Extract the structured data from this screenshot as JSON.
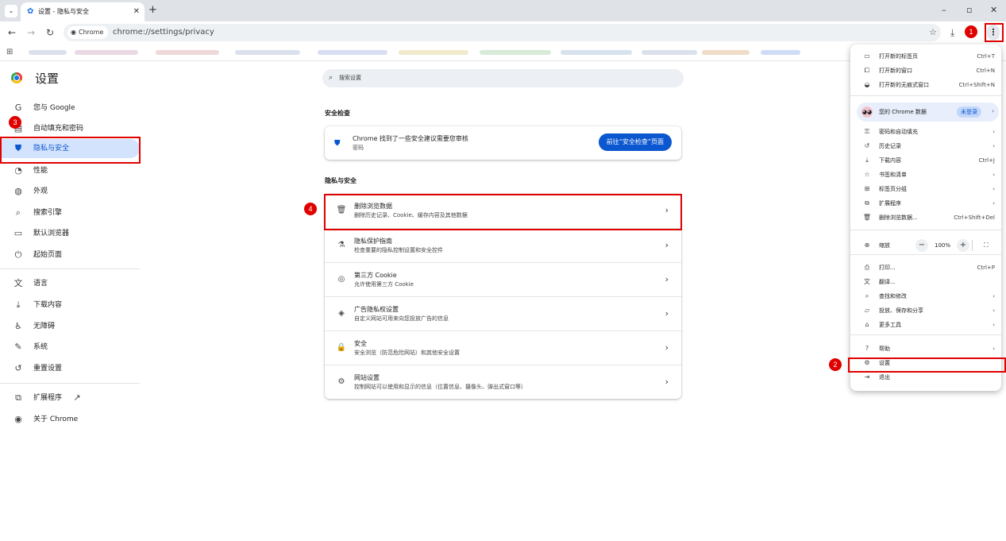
{
  "browser": {
    "tab_title": "设置 - 隐私与安全",
    "tab_close": "✕",
    "new_tab": "+",
    "chip_label": "Chrome",
    "url": "chrome://settings/privacy"
  },
  "annotations": [
    "1",
    "2",
    "3",
    "4"
  ],
  "settings": {
    "title": "设置",
    "search_placeholder": "搜索设置",
    "sidebar": [
      {
        "label": "您与 Google",
        "icon": "google-g-icon"
      },
      {
        "label": "自动填充和密码",
        "icon": "autofill-icon"
      },
      {
        "label": "隐私与安全",
        "icon": "shield-icon",
        "active": true
      },
      {
        "label": "性能",
        "icon": "speedometer-icon"
      },
      {
        "label": "外观",
        "icon": "palette-icon"
      },
      {
        "label": "搜索引擎",
        "icon": "search-icon"
      },
      {
        "label": "默认浏览器",
        "icon": "browser-window-icon"
      },
      {
        "label": "起始页面",
        "icon": "power-icon"
      },
      {
        "label": "语言",
        "icon": "translate-icon"
      },
      {
        "label": "下载内容",
        "icon": "download-icon"
      },
      {
        "label": "无障碍",
        "icon": "accessibility-icon"
      },
      {
        "label": "系统",
        "icon": "wrench-icon"
      },
      {
        "label": "重置设置",
        "icon": "reset-icon"
      },
      {
        "label": "扩展程序",
        "icon": "puzzle-icon"
      },
      {
        "label": "关于 Chrome",
        "icon": "chrome-logo-icon"
      }
    ],
    "safety_check": {
      "section_title": "安全检查",
      "title": "Chrome 找到了一些安全建议需要您审核",
      "subtitle": "密码",
      "button": "前往“安全检查”页面"
    },
    "privacy": {
      "section_title": "隐私与安全",
      "rows": [
        {
          "title": "删除浏览数据",
          "subtitle": "删除历史记录、Cookie、缓存内容及其他数据",
          "icon": "trash-icon"
        },
        {
          "title": "隐私保护指南",
          "subtitle": "检查重要的隐私控制设置和安全控件",
          "icon": "privacy-guide-icon"
        },
        {
          "title": "第三方 Cookie",
          "subtitle": "允许使用第三方 Cookie",
          "icon": "cookie-icon"
        },
        {
          "title": "广告隐私权设置",
          "subtitle": "自定义网站可用来向您投放广告的信息",
          "icon": "ad-privacy-icon"
        },
        {
          "title": "安全",
          "subtitle": "安全浏览（防范危险网站）和其他安全设置",
          "icon": "lock-icon"
        },
        {
          "title": "网站设置",
          "subtitle": "控制网站可以使用和显示的信息（位置信息、摄像头、弹出式窗口等）",
          "icon": "site-settings-icon"
        }
      ]
    }
  },
  "menu": {
    "top_items": [
      {
        "label": "打开新的标签页",
        "shortcut": "Ctrl+T"
      },
      {
        "label": "打开新的窗口",
        "shortcut": "Ctrl+N"
      },
      {
        "label": "打开新的无痕式窗口",
        "shortcut": "Ctrl+Shift+N"
      }
    ],
    "profile_label": "您的 Chrome 数据",
    "profile_badge": "未登录",
    "mid_items": [
      {
        "label": "密码和自动填充",
        "shortcut": "›"
      },
      {
        "label": "历史记录",
        "shortcut": "›"
      },
      {
        "label": "下载内容",
        "shortcut": "Ctrl+J"
      },
      {
        "label": "书签和清单",
        "shortcut": "›"
      },
      {
        "label": "标签页分组",
        "shortcut": "›"
      },
      {
        "label": "扩展程序",
        "shortcut": "›"
      },
      {
        "label": "删除浏览数据...",
        "shortcut": "Ctrl+Shift+Del"
      }
    ],
    "zoom_label": "缩放",
    "zoom_value": "100%",
    "zoom_minus": "−",
    "zoom_plus": "+",
    "tool_items": [
      {
        "label": "打印...",
        "shortcut": "Ctrl+P"
      },
      {
        "label": "翻译...",
        "shortcut": ""
      },
      {
        "label": "查找和修改",
        "shortcut": "›"
      },
      {
        "label": "投放、保存和分享",
        "shortcut": "›"
      },
      {
        "label": "更多工具",
        "shortcut": "›"
      }
    ],
    "bottom_items": [
      {
        "label": "帮助",
        "shortcut": "›"
      },
      {
        "label": "设置",
        "shortcut": ""
      },
      {
        "label": "退出",
        "shortcut": ""
      }
    ]
  },
  "colors": {
    "accent": "#0b57d0",
    "annotation": "#e00000",
    "active_nav": "#d3e3fd"
  }
}
